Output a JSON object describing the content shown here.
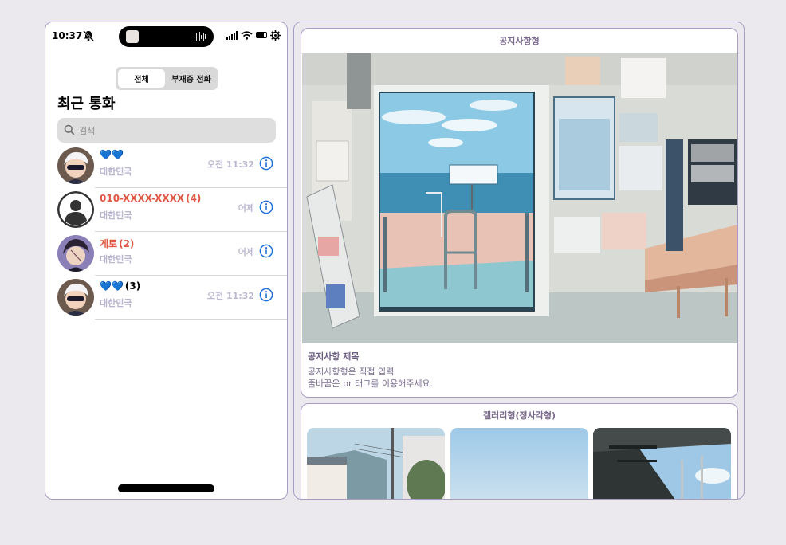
{
  "phone": {
    "status": {
      "time": "10:37"
    },
    "segments": [
      "전체",
      "부재중 전화"
    ],
    "title": "최근 통화",
    "search_placeholder": "검색",
    "calls": [
      {
        "name": "💙💙",
        "count": "",
        "subtitle": "대한민국",
        "time": "오전 11:32",
        "missed": false
      },
      {
        "name": "010-XXXX-XXXX",
        "count": "(4)",
        "subtitle": "대한민국",
        "time": "어제",
        "missed": true
      },
      {
        "name": "게토",
        "count": "(2)",
        "subtitle": "대한민국",
        "time": "어제",
        "missed": true
      },
      {
        "name": "💙💙",
        "count": "(3)",
        "subtitle": "대한민국",
        "time": "오전 11:32",
        "missed": false
      }
    ]
  },
  "notice": {
    "header": "공지사항형",
    "title": "공지사항 제목",
    "body_line1": "공지사항형은 직접 입력",
    "body_line2": "줄바꿈은 br 태그를 이용해주세요."
  },
  "gallery": {
    "header": "갤러리형(정사각형)"
  },
  "colors": {
    "accent": "#1d6fd8",
    "missed": "#e05743",
    "border": "#a89cc4"
  }
}
